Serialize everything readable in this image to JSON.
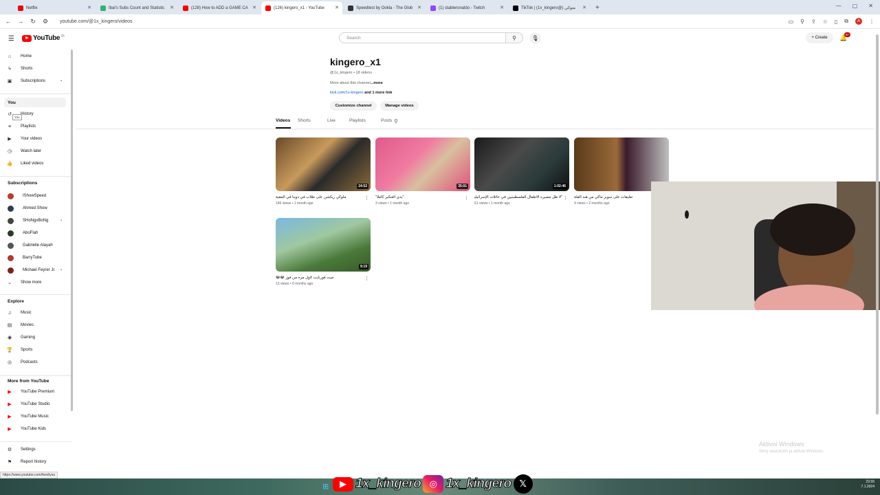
{
  "browser": {
    "tabs": [
      {
        "title": "Netflix",
        "color": "#e50914"
      },
      {
        "title": "Ibai's Subs Count and Statistic",
        "color": "#2bb673"
      },
      {
        "title": "(128) How to ADD a GAME CA",
        "color": "#ff0000"
      },
      {
        "title": "(126) kingero_x1 - YouTube",
        "color": "#ff0000"
      },
      {
        "title": "Speedtest by Ookla - The Glob",
        "color": "#333333"
      },
      {
        "title": "(1) stableronaldo - Twitch",
        "color": "#9146ff"
      },
      {
        "title": "TikTok | (1x_kingero@) متوكي",
        "color": "#000000"
      }
    ],
    "active_tab": 3,
    "new_tab": "+",
    "url": "youtube.com/@1x_kingero/videos"
  },
  "header": {
    "logo_text": "YouTube",
    "logo_suffix": "FI",
    "search_placeholder": "Search",
    "create_label": "+ Create",
    "notif_count": "9+"
  },
  "sidebar": {
    "main": [
      {
        "label": "Home",
        "icon": "home-icon",
        "glyph": "⌂"
      },
      {
        "label": "Shorts",
        "icon": "shorts-icon",
        "glyph": "ϟ"
      },
      {
        "label": "Subscriptions",
        "icon": "subscriptions-icon",
        "glyph": "▣"
      }
    ],
    "you_heading": "You",
    "you_tooltip": "You",
    "you_items": [
      {
        "label": "History",
        "icon": "history-icon",
        "glyph": "↺"
      },
      {
        "label": "Playlists",
        "icon": "playlists-icon",
        "glyph": "≡"
      },
      {
        "label": "Your videos",
        "icon": "your-videos-icon",
        "glyph": "▶"
      },
      {
        "label": "Watch later",
        "icon": "watch-later-icon",
        "glyph": "◷"
      },
      {
        "label": "Liked videos",
        "icon": "liked-videos-icon",
        "glyph": "👍"
      }
    ],
    "subs_heading": "Subscriptions",
    "subs": [
      {
        "label": "IShowSpeed",
        "color": "#c0392b"
      },
      {
        "label": "Ahmed Show",
        "color": "#2c3e50"
      },
      {
        "label": "SHoNgxBoNg",
        "color": "#444444"
      },
      {
        "label": "AboFlah",
        "color": "#2d3a2a"
      },
      {
        "label": "Gabrielle Alayah",
        "color": "#555555"
      },
      {
        "label": "BarryTube",
        "color": "#b03a2e"
      },
      {
        "label": "Michael Feyrer Jr.",
        "color": "#7b241c"
      }
    ],
    "show_more": "Show more",
    "explore_heading": "Explore",
    "explore": [
      {
        "label": "Music",
        "icon": "music-icon",
        "glyph": "♫"
      },
      {
        "label": "Movies",
        "icon": "movies-icon",
        "glyph": "▤"
      },
      {
        "label": "Gaming",
        "icon": "gaming-icon",
        "glyph": "◉"
      },
      {
        "label": "Sports",
        "icon": "sports-icon",
        "glyph": "🏆"
      },
      {
        "label": "Podcasts",
        "icon": "podcasts-icon",
        "glyph": "◎"
      }
    ],
    "more_heading": "More from YouTube",
    "more": [
      {
        "label": "YouTube Premium",
        "color": "#ff0000"
      },
      {
        "label": "YouTube Studio",
        "color": "#ff0000"
      },
      {
        "label": "YouTube Music",
        "color": "#ff0000"
      },
      {
        "label": "YouTube Kids",
        "color": "#ff0000"
      }
    ],
    "settings": "Settings",
    "report": "Report history"
  },
  "status_url": "https://www.youtube.com/feed/you",
  "channel": {
    "name": "kingero_x1",
    "handle_meta": "@1x_kingero • 18 videos",
    "about": "More about this channel",
    "about_more": "...more",
    "link": "kick.com/1x-kingero",
    "link_more": " and 1 more link",
    "customize": "Customize channel",
    "manage": "Manage videos"
  },
  "channel_tabs": [
    "Videos",
    "Shorts",
    "Live",
    "Playlists",
    "Posts"
  ],
  "videos": [
    {
      "title": "ملوكي ريكشن على طلاب في دوينا في المقبة",
      "meta": "146 views • 1 month ago",
      "duration": "24:52",
      "bg": "linear-gradient(135deg,#6b4a2b,#c89a5c 40%,#2a2a2a 60%,#8a6a3a)"
    },
    {
      "title": "\"بدي العنكبر كاملا\"",
      "meta": "3 views • 1 month ago",
      "duration": "35:01",
      "bg": "linear-gradient(135deg,#e05a8a,#f07aa0 40%,#d8c0a0 60%,#e0507a)"
    },
    {
      "title": "\"لا ظل مصيره الأطفال الفلسطينيين في عائلات الإسرائيليين",
      "meta": "61 views • 1 month ago",
      "duration": "1:02:46",
      "bg": "linear-gradient(135deg,#1a1a1a,#4a4a4a 40%,#2a3a3a 70%,#111)"
    },
    {
      "title": "تعليقات على سوبر ماكي من هند الفلة",
      "meta": "4 views • 2 months ago",
      "duration": "",
      "bg": "linear-gradient(90deg,#5a3a1a,#9a6a3a 45%,#3a1a2a 55%,#c0c0c0)"
    },
    {
      "title": "جيت فورنايت لاول مره من فوز 😂😂",
      "meta": "13 views • 6 months ago",
      "duration": "9:19",
      "bg": "linear-gradient(160deg,#7ab8e0,#a0c8a0 40%,#4a7a3a 70%,#3a5a2a)"
    }
  ],
  "watermark": {
    "line1": "Aktivoi Windows",
    "line2": "Siirry asetuksiin ja aktivoi Windows."
  },
  "banner": {
    "handle1": "1x_kingero",
    "handle2": "1x_kingero"
  },
  "clock": {
    "time": "23.55",
    "date": "7.1.2024"
  }
}
